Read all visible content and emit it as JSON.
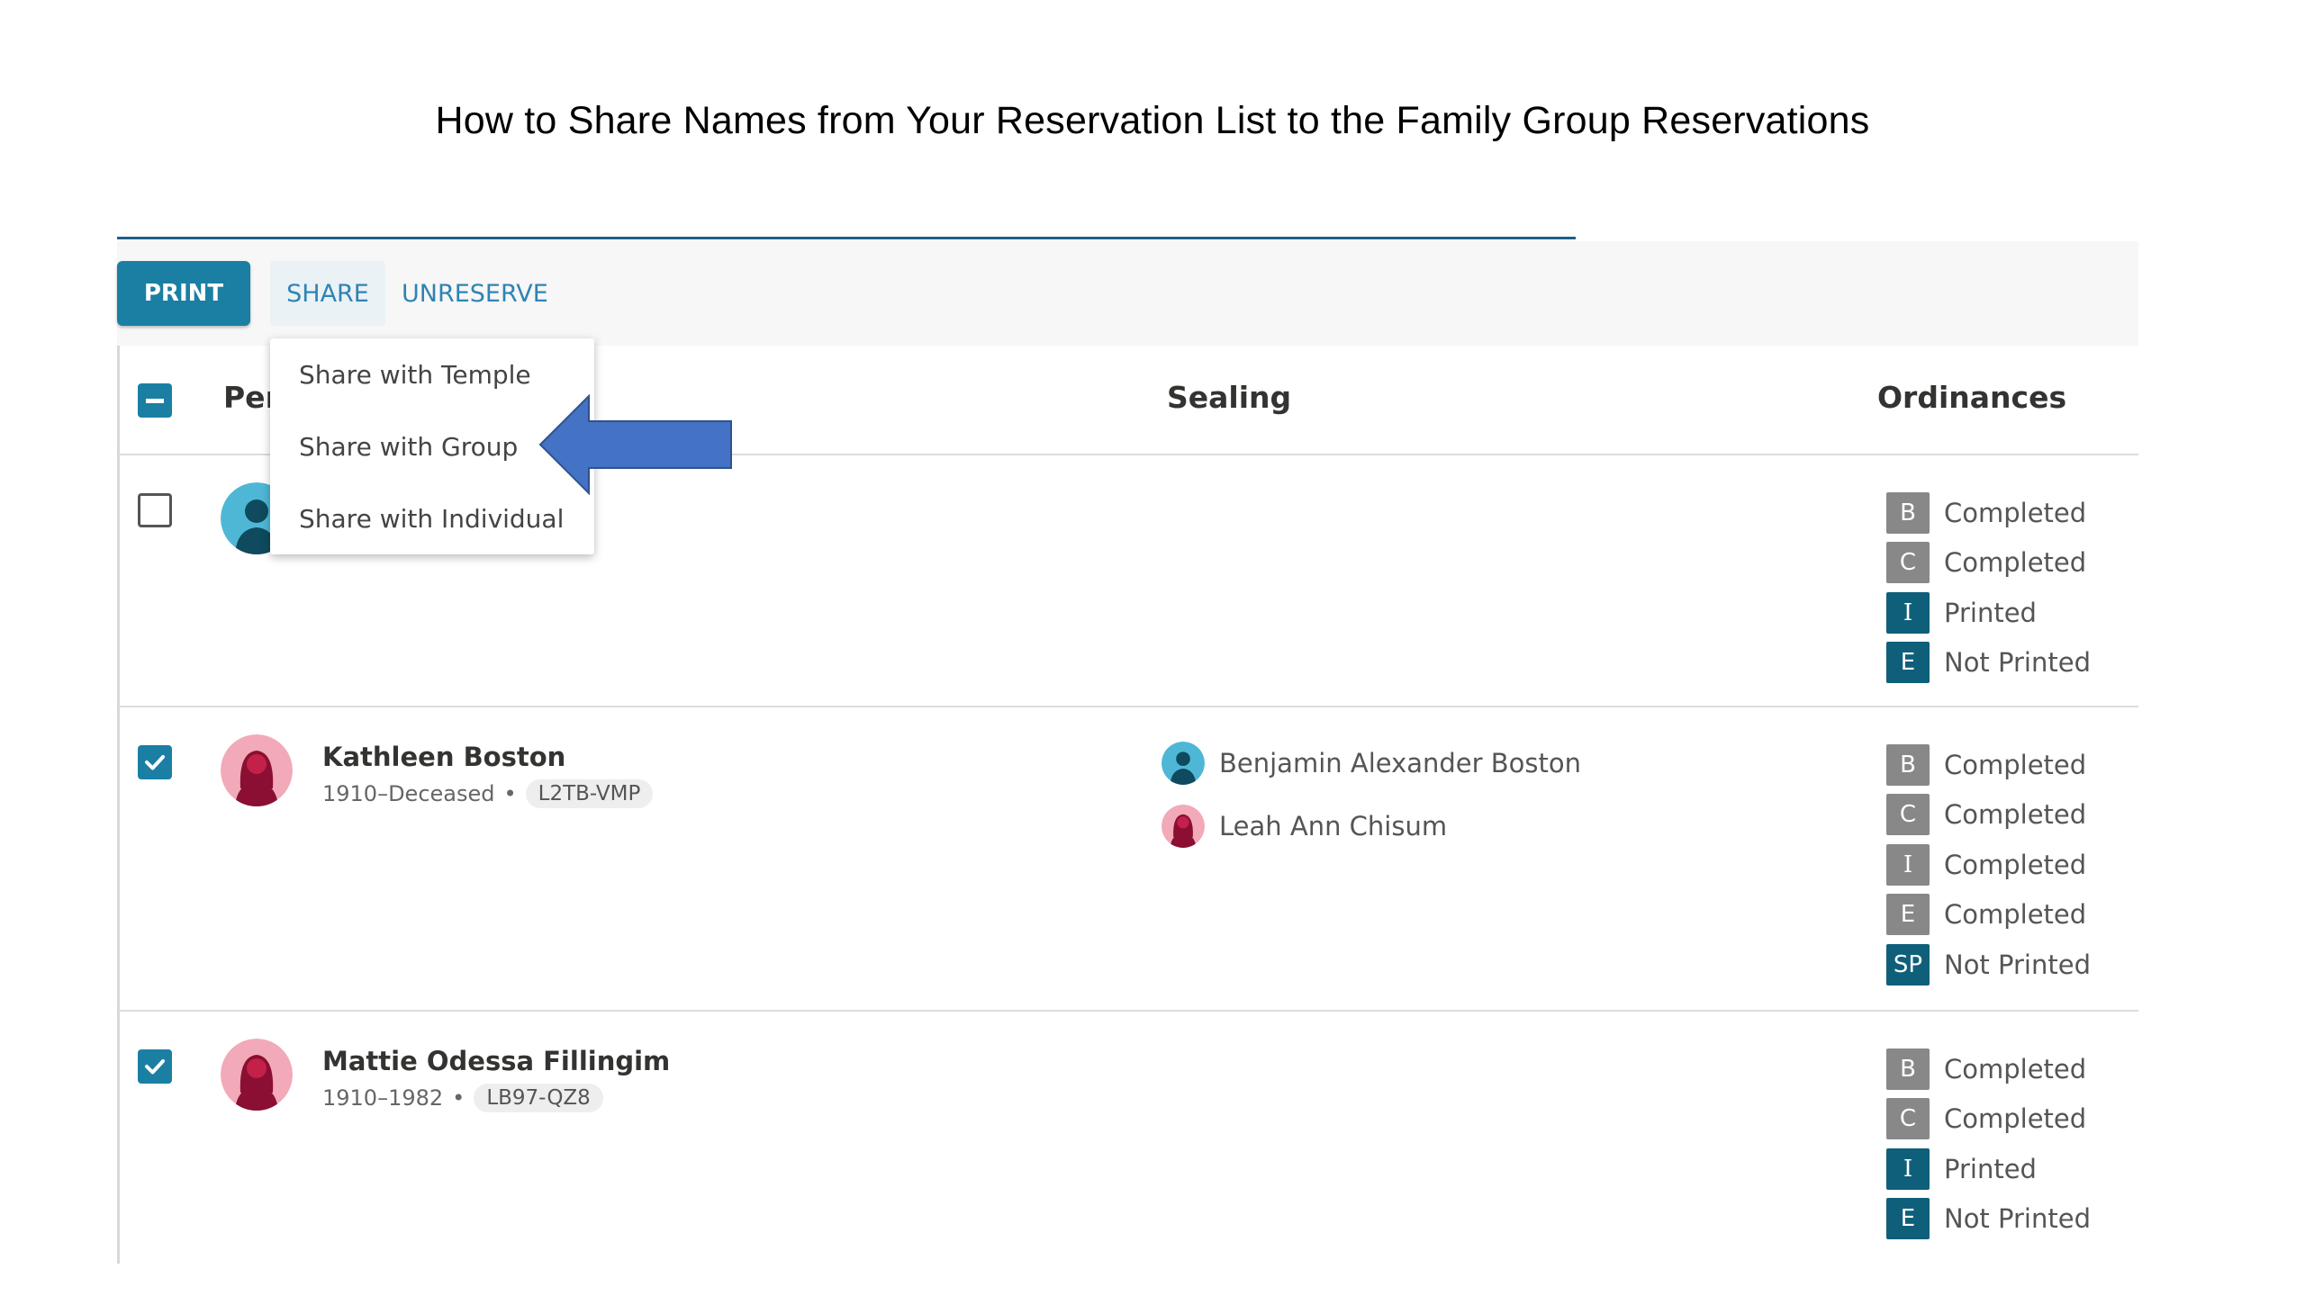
{
  "slide": {
    "title": "How to Share Names from Your Reservation List to the Family Group Reservations"
  },
  "toolbar": {
    "print_label": "PRINT",
    "share_label": "SHARE",
    "unreserve_label": "UNRESERVE"
  },
  "share_menu": {
    "items": [
      "Share with Temple",
      "Share with Group",
      "Share with Individual"
    ],
    "highlighted_item": "Share with Group"
  },
  "table": {
    "headers": {
      "person": "Per",
      "sealing": "Sealing",
      "ordinances": "Ordinances"
    },
    "rows": [
      {
        "checked": false,
        "avatar": "male-avatar-icon",
        "ordinances": [
          {
            "code": "B",
            "status": "Completed"
          },
          {
            "code": "C",
            "status": "Completed"
          },
          {
            "code": "I",
            "status": "Printed"
          },
          {
            "code": "E",
            "status": "Not Printed"
          }
        ]
      },
      {
        "checked": true,
        "avatar": "female-avatar-icon",
        "name": "Kathleen Boston",
        "lifespan": "1910–Deceased",
        "person_id": "L2TB-VMP",
        "sealing": [
          {
            "name": "Benjamin Alexander Boston",
            "avatar": "male-avatar-icon"
          },
          {
            "name": "Leah Ann Chisum",
            "avatar": "female-avatar-icon"
          }
        ],
        "ordinances": [
          {
            "code": "B",
            "status": "Completed"
          },
          {
            "code": "C",
            "status": "Completed"
          },
          {
            "code": "I",
            "status": "Completed"
          },
          {
            "code": "E",
            "status": "Completed"
          },
          {
            "code": "SP",
            "status": "Not Printed"
          }
        ]
      },
      {
        "checked": true,
        "avatar": "female-avatar-icon",
        "name": "Mattie Odessa Fillingim",
        "lifespan": "1910–1982",
        "person_id": "LB97-QZ8",
        "ordinances": [
          {
            "code": "B",
            "status": "Completed"
          },
          {
            "code": "C",
            "status": "Completed"
          },
          {
            "code": "I",
            "status": "Printed"
          },
          {
            "code": "E",
            "status": "Not Printed"
          }
        ]
      }
    ]
  },
  "colors": {
    "accent": "#1a7fa3",
    "completed_badge": "#888888",
    "pending_badge": "#0f5f7a",
    "arrow": "#4472c4"
  }
}
